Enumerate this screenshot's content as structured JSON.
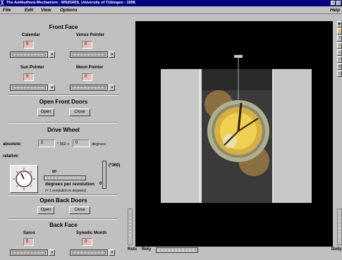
{
  "window": {
    "title": "The Antikythera Mechanism - WSI/GRIS, University of Tübingen - 1998"
  },
  "menu": {
    "file": "File",
    "edit": "Edit",
    "view": "View",
    "options": "Options",
    "help": "Help"
  },
  "front_face": {
    "heading": "Front Face",
    "calendar_label": "Calendar",
    "calendar_value": "0",
    "venus_label": "Venus Pointer",
    "venus_value": "0",
    "sun_label": "Sun Pointer",
    "sun_value": "0",
    "moon_label": "Moon Pointer",
    "moon_value": "0"
  },
  "front_doors": {
    "heading": "Open Front Doors",
    "open": "Open",
    "close": "Close"
  },
  "drive_wheel": {
    "heading": "Drive Wheel",
    "absolute_label": "absolute:",
    "absolute_a": "0",
    "absolute_mult": "* 360 +",
    "absolute_b": "0",
    "degrees": "degrees",
    "relative_label": "relative:",
    "dpr_value": "60",
    "dpr_label": "degrees per revolution",
    "dpr_hint": "(= 1 revolution in degrees)",
    "x360_label": "(*360)",
    "x360_value": "0"
  },
  "back_doors": {
    "heading": "Open Back Doors",
    "open": "Open",
    "close": "Close"
  },
  "back_face": {
    "heading": "Back Face",
    "saros_label": "Saros",
    "saros_value": "0",
    "synodic_label": "Synodic Month",
    "synodic_value": "0"
  },
  "viewer": {
    "rotx": "Rotx",
    "roty": "Roty",
    "dolly": "Dolly"
  },
  "colors": {
    "title_bar": "#000080",
    "field_bg": "#e8bcbc",
    "dial_gold": "#e8c84a",
    "dial_ring": "#a8a890"
  }
}
